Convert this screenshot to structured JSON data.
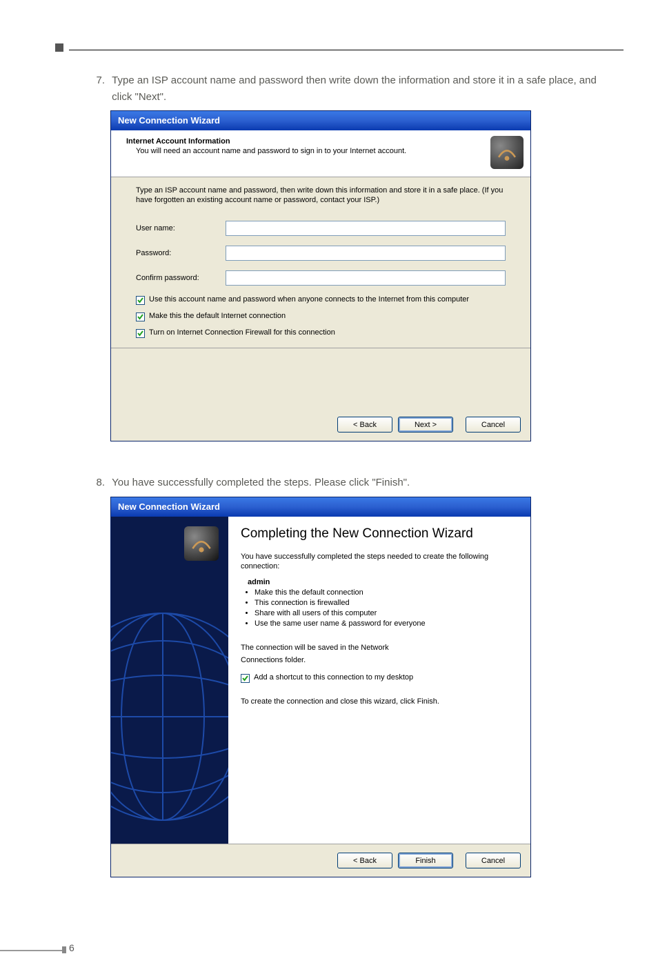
{
  "page_number": "6",
  "step7": {
    "num": "7.",
    "text": "Type an ISP account name and password then write down the information and store it in a safe place, and click \"Next\"."
  },
  "step8": {
    "num": "8.",
    "text": "You have successfully completed the steps. Please click \"Finish\"."
  },
  "dialog1": {
    "title": "New Connection Wizard",
    "header_title": "Internet Account Information",
    "header_sub": "You will need an account name and password to sign in to your Internet account.",
    "intro": "Type an ISP account name and password, then write down this information and store it in a safe place. (If you have forgotten an existing account name or password, contact your ISP.)",
    "username_label": "User name:",
    "username_value": "",
    "password_label": "Password:",
    "password_value": "",
    "confirm_label": "Confirm password:",
    "confirm_value": "",
    "chk1": "Use this account name and password when anyone connects to the Internet from this computer",
    "chk2": "Make this the default Internet connection",
    "chk3": "Turn on Internet Connection Firewall for this connection",
    "back": "< Back",
    "next": "Next >",
    "cancel": "Cancel"
  },
  "dialog2": {
    "title": "New Connection Wizard",
    "heading": "Completing the New Connection Wizard",
    "p1": "You have successfully completed the steps needed to create the following connection:",
    "conn_name": "admin",
    "bullets": [
      "Make this the default connection",
      "This connection is firewalled",
      "Share with all users of this computer",
      "Use the same user name & password for everyone"
    ],
    "p2a": "The connection will be saved in the Network",
    "p2b": "Connections folder.",
    "chk": "Add a shortcut to this connection to my desktop",
    "p3": "To create the connection and close this wizard, click Finish.",
    "back": "< Back",
    "finish": "Finish",
    "cancel": "Cancel"
  }
}
